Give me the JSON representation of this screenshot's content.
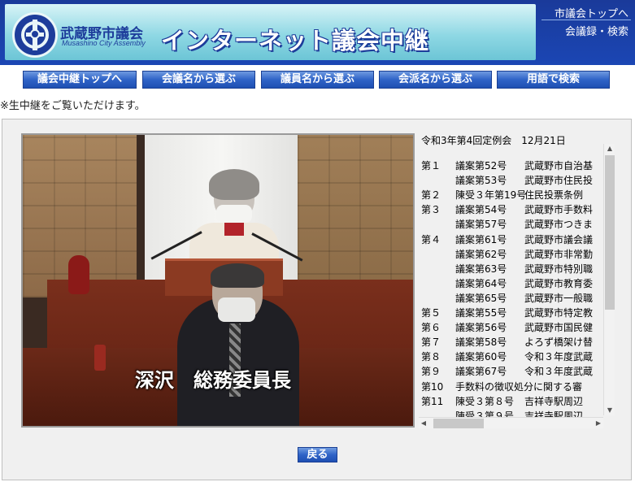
{
  "header": {
    "logo_name": "武蔵野市議会",
    "logo_sub": "Musashino City Assembly",
    "site_title": "インターネット議会中継",
    "link_top": "市議会トップへ",
    "link_minutes": "会議録・検索"
  },
  "nav": {
    "items": [
      {
        "label": "議会中継トップへ"
      },
      {
        "label": "会議名から選ぶ"
      },
      {
        "label": "議員名から選ぶ"
      },
      {
        "label": "会派名から選ぶ"
      },
      {
        "label": "用語で検索"
      }
    ]
  },
  "notice": "※生中継をご覧いただけます。",
  "video": {
    "caption": "深沢　総務委員長"
  },
  "agenda": {
    "heading": "令和3年第4回定例会　12月21日",
    "lines": [
      {
        "num": "第１",
        "item": "議案第52号",
        "title": "武蔵野市自治基"
      },
      {
        "num": "",
        "item": "議案第53号",
        "title": "武蔵野市住民投"
      },
      {
        "num": "第２",
        "item": "陳受３年第19号",
        "title": "住民投票条例"
      },
      {
        "num": "第３",
        "item": "議案第54号",
        "title": "武蔵野市手数料"
      },
      {
        "num": "",
        "item": "議案第57号",
        "title": "武蔵野市つきま"
      },
      {
        "num": "第４",
        "item": "議案第61号",
        "title": "武蔵野市議会議"
      },
      {
        "num": "",
        "item": "議案第62号",
        "title": "武蔵野市非常勤"
      },
      {
        "num": "",
        "item": "議案第63号",
        "title": "武蔵野市特別職"
      },
      {
        "num": "",
        "item": "議案第64号",
        "title": "武蔵野市教育委"
      },
      {
        "num": "",
        "item": "議案第65号",
        "title": "武蔵野市一般職"
      },
      {
        "num": "第５",
        "item": "議案第55号",
        "title": "武蔵野市特定教"
      },
      {
        "num": "第６",
        "item": "議案第56号",
        "title": "武蔵野市国民健"
      },
      {
        "num": "第７",
        "item": "議案第58号",
        "title": "よろず橋架け替"
      },
      {
        "num": "第８",
        "item": "議案第60号",
        "title": "令和３年度武蔵"
      },
      {
        "num": "第９",
        "item": "議案第67号",
        "title": "令和３年度武蔵"
      },
      {
        "num": "第10",
        "item": "手数料の徴収処分に関する審",
        "title": ""
      },
      {
        "num": "第11",
        "item": "陳受３第８号",
        "title": "吉祥寺駅周辺"
      },
      {
        "num": "",
        "item": "陳受３第９号",
        "title": "吉祥寺駅周辺"
      }
    ]
  },
  "back_button": "戻る",
  "colors": {
    "header_blue": "#1b46b4",
    "header_cyan": "#8fd8e4",
    "nav_blue": "#2f63c7"
  }
}
